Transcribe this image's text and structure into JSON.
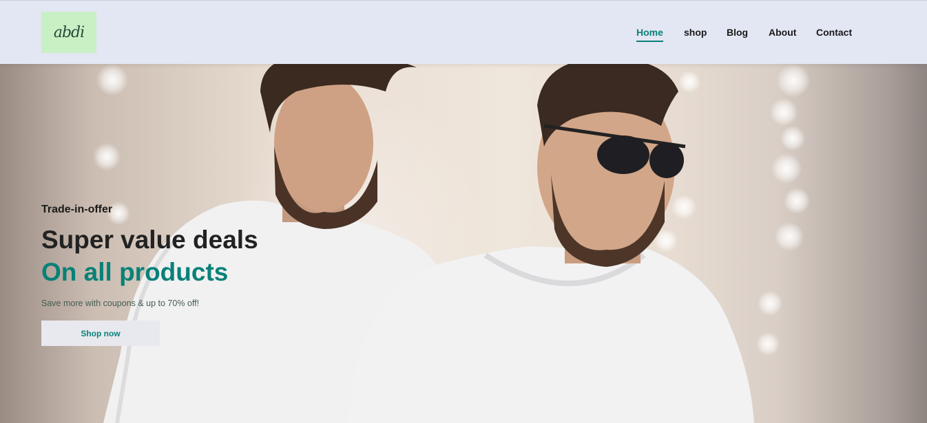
{
  "brand": {
    "logo_text": "abdi"
  },
  "nav": {
    "items": [
      {
        "label": "Home",
        "active": true
      },
      {
        "label": "shop",
        "active": false
      },
      {
        "label": "Blog",
        "active": false
      },
      {
        "label": "About",
        "active": false
      },
      {
        "label": "Contact",
        "active": false
      }
    ]
  },
  "hero": {
    "tagline": "Trade-in-offer",
    "headline": "Super value deals",
    "subheadline": "On all products",
    "description": "Save more with coupons & up to 70% off!",
    "cta_label": "Shop now",
    "image_alt": "Two bearded men in white t-shirts"
  },
  "colors": {
    "accent": "#088178",
    "header_bg": "#e3e6f3",
    "logo_bg": "#c9f0c4",
    "button_bg": "#e8e9ef"
  }
}
